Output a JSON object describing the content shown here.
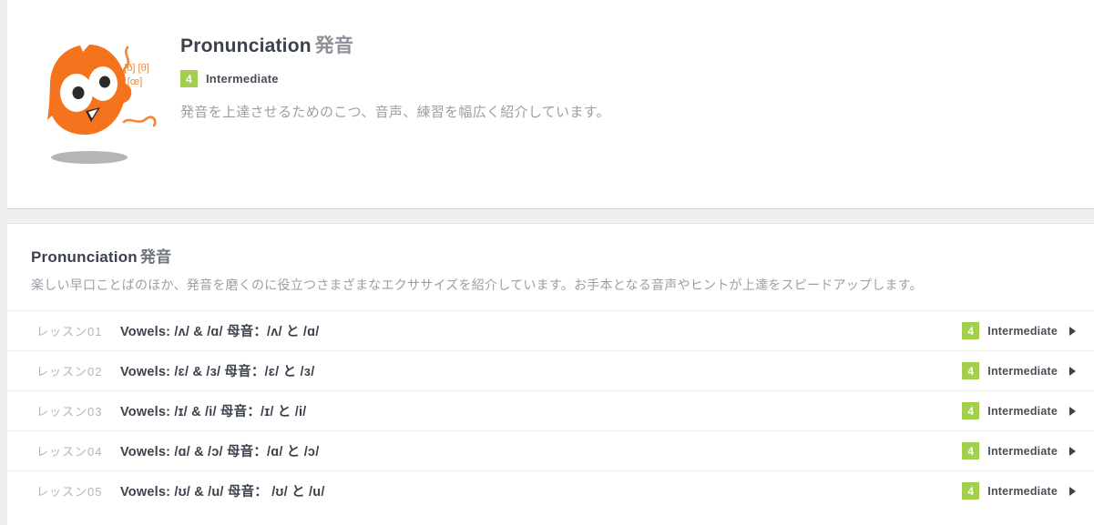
{
  "hero": {
    "mascot_icon": "owl-mascot-icon",
    "ipa_line1": "[ð] [θ]",
    "ipa_line2": "[œ]",
    "title_en": "Pronunciation",
    "title_jp": "発音",
    "level_number": "4",
    "level_label": "Intermediate",
    "description": "発音を上達させるためのこつ、音声、練習を幅広く紹介しています。"
  },
  "lesson_section": {
    "title_en": "Pronunciation",
    "title_jp": "発音",
    "description": "楽しい早口ことばのほか、発音を磨くのに役立つさまざまなエクササイズを紹介しています。お手本となる音声やヒントが上達をスピードアップします。",
    "lessons": [
      {
        "number": "レッスン01",
        "title": "Vowels: /ʌ/ & /ɑ/ 母音：/ʌ/ と /ɑ/",
        "level_number": "4",
        "level_label": "Intermediate",
        "arrow_icon": "chevron-right-icon"
      },
      {
        "number": "レッスン02",
        "title": "Vowels: /ɛ/ & /ɜ/ 母音：/ɛ/ と /ɜ/",
        "level_number": "4",
        "level_label": "Intermediate",
        "arrow_icon": "chevron-right-icon"
      },
      {
        "number": "レッスン03",
        "title": "Vowels: /ɪ/ & /i/ 母音：/ɪ/ と /i/",
        "level_number": "4",
        "level_label": "Intermediate",
        "arrow_icon": "chevron-right-icon"
      },
      {
        "number": "レッスン04",
        "title": "Vowels: /ɑ/ & /ɔ/ 母音：/ɑ/ と /ɔ/",
        "level_number": "4",
        "level_label": "Intermediate",
        "arrow_icon": "chevron-right-icon"
      },
      {
        "number": "レッスン05",
        "title": "Vowels: /ʊ/ & /u/ 母音： /ʊ/ と /u/",
        "level_number": "4",
        "level_label": "Intermediate",
        "arrow_icon": "chevron-right-icon"
      }
    ]
  },
  "colors": {
    "badge_green": "#a3ce4e",
    "mascot_orange": "#f4731c",
    "page_background": "#efefef",
    "card_background": "#ffffff",
    "title_text": "#3b424c",
    "muted_text": "#9aa0a6"
  }
}
